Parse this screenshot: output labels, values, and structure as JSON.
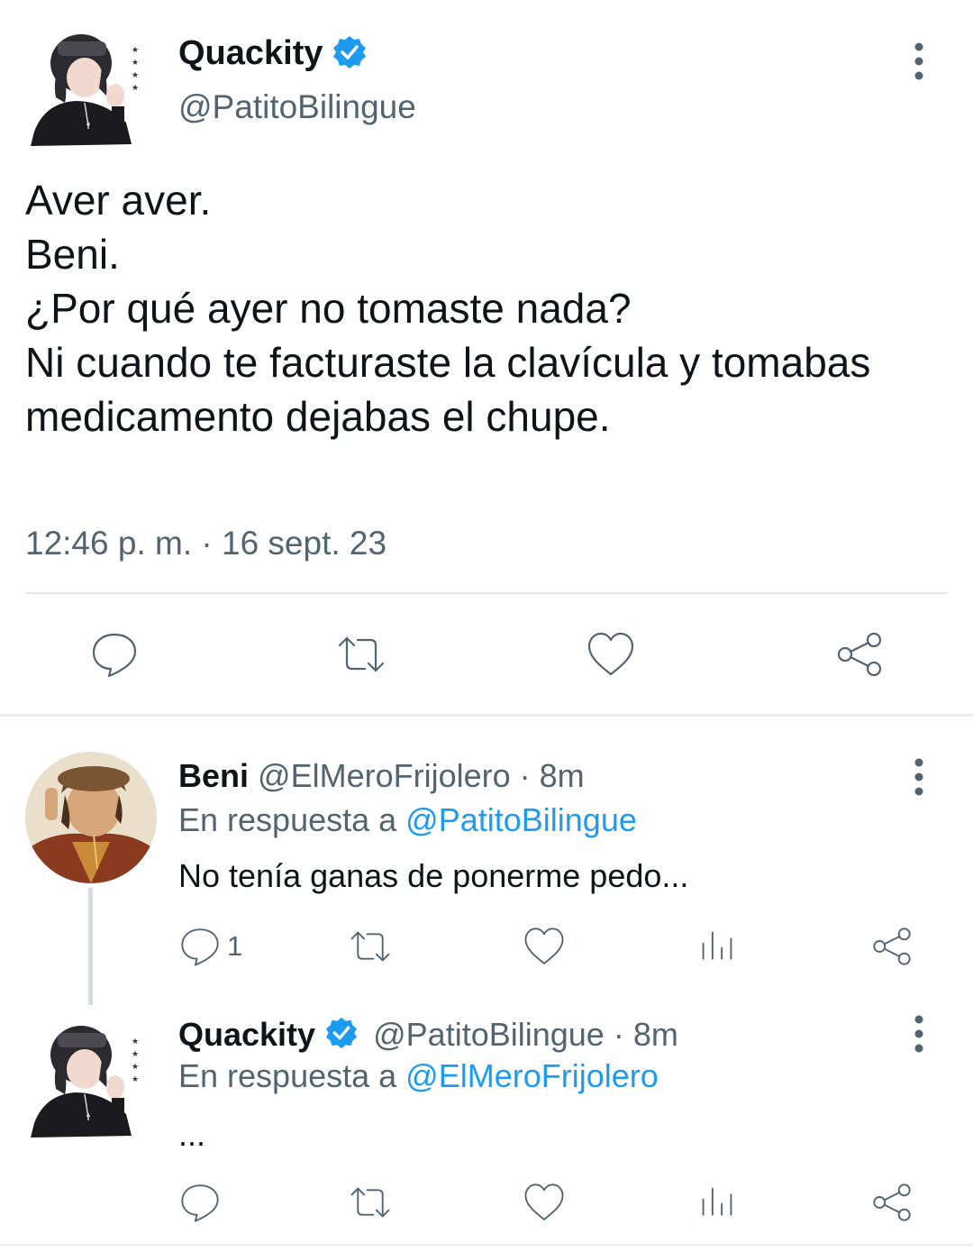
{
  "main_tweet": {
    "name": "Quackity",
    "handle": "@PatitoBilingue",
    "text_lines": [
      "Aver aver.",
      "Beni.",
      "¿Por qué ayer no tomaste nada?",
      "Ni cuando te facturaste la clavícula y tomabas",
      "medicamento dejabas el chupe."
    ],
    "timestamp": "12:46 p. m. · 16 sept. 23",
    "actions": [
      "reply-icon",
      "retweet-icon",
      "like-icon",
      "share-icon"
    ]
  },
  "replies": [
    {
      "name": "Beni",
      "handle": "@ElMeroFrijolero",
      "time": "· 8m",
      "reply_prefix": "En respuesta a",
      "reply_to": "@PatitoBilingue",
      "text": "No tenía ganas de ponerme pedo...",
      "reply_count": "1"
    },
    {
      "name": "Quackity",
      "handle": "@PatitoBilingue",
      "time": "· 8m",
      "reply_prefix": "En respuesta a",
      "reply_to": "@ElMeroFrijolero",
      "text": "...",
      "reply_count": ""
    }
  ],
  "colors": {
    "accent": "#1d9bf0",
    "secondary_text": "#536471",
    "primary_text": "#0f1419",
    "verified": "#1d9bf0"
  }
}
